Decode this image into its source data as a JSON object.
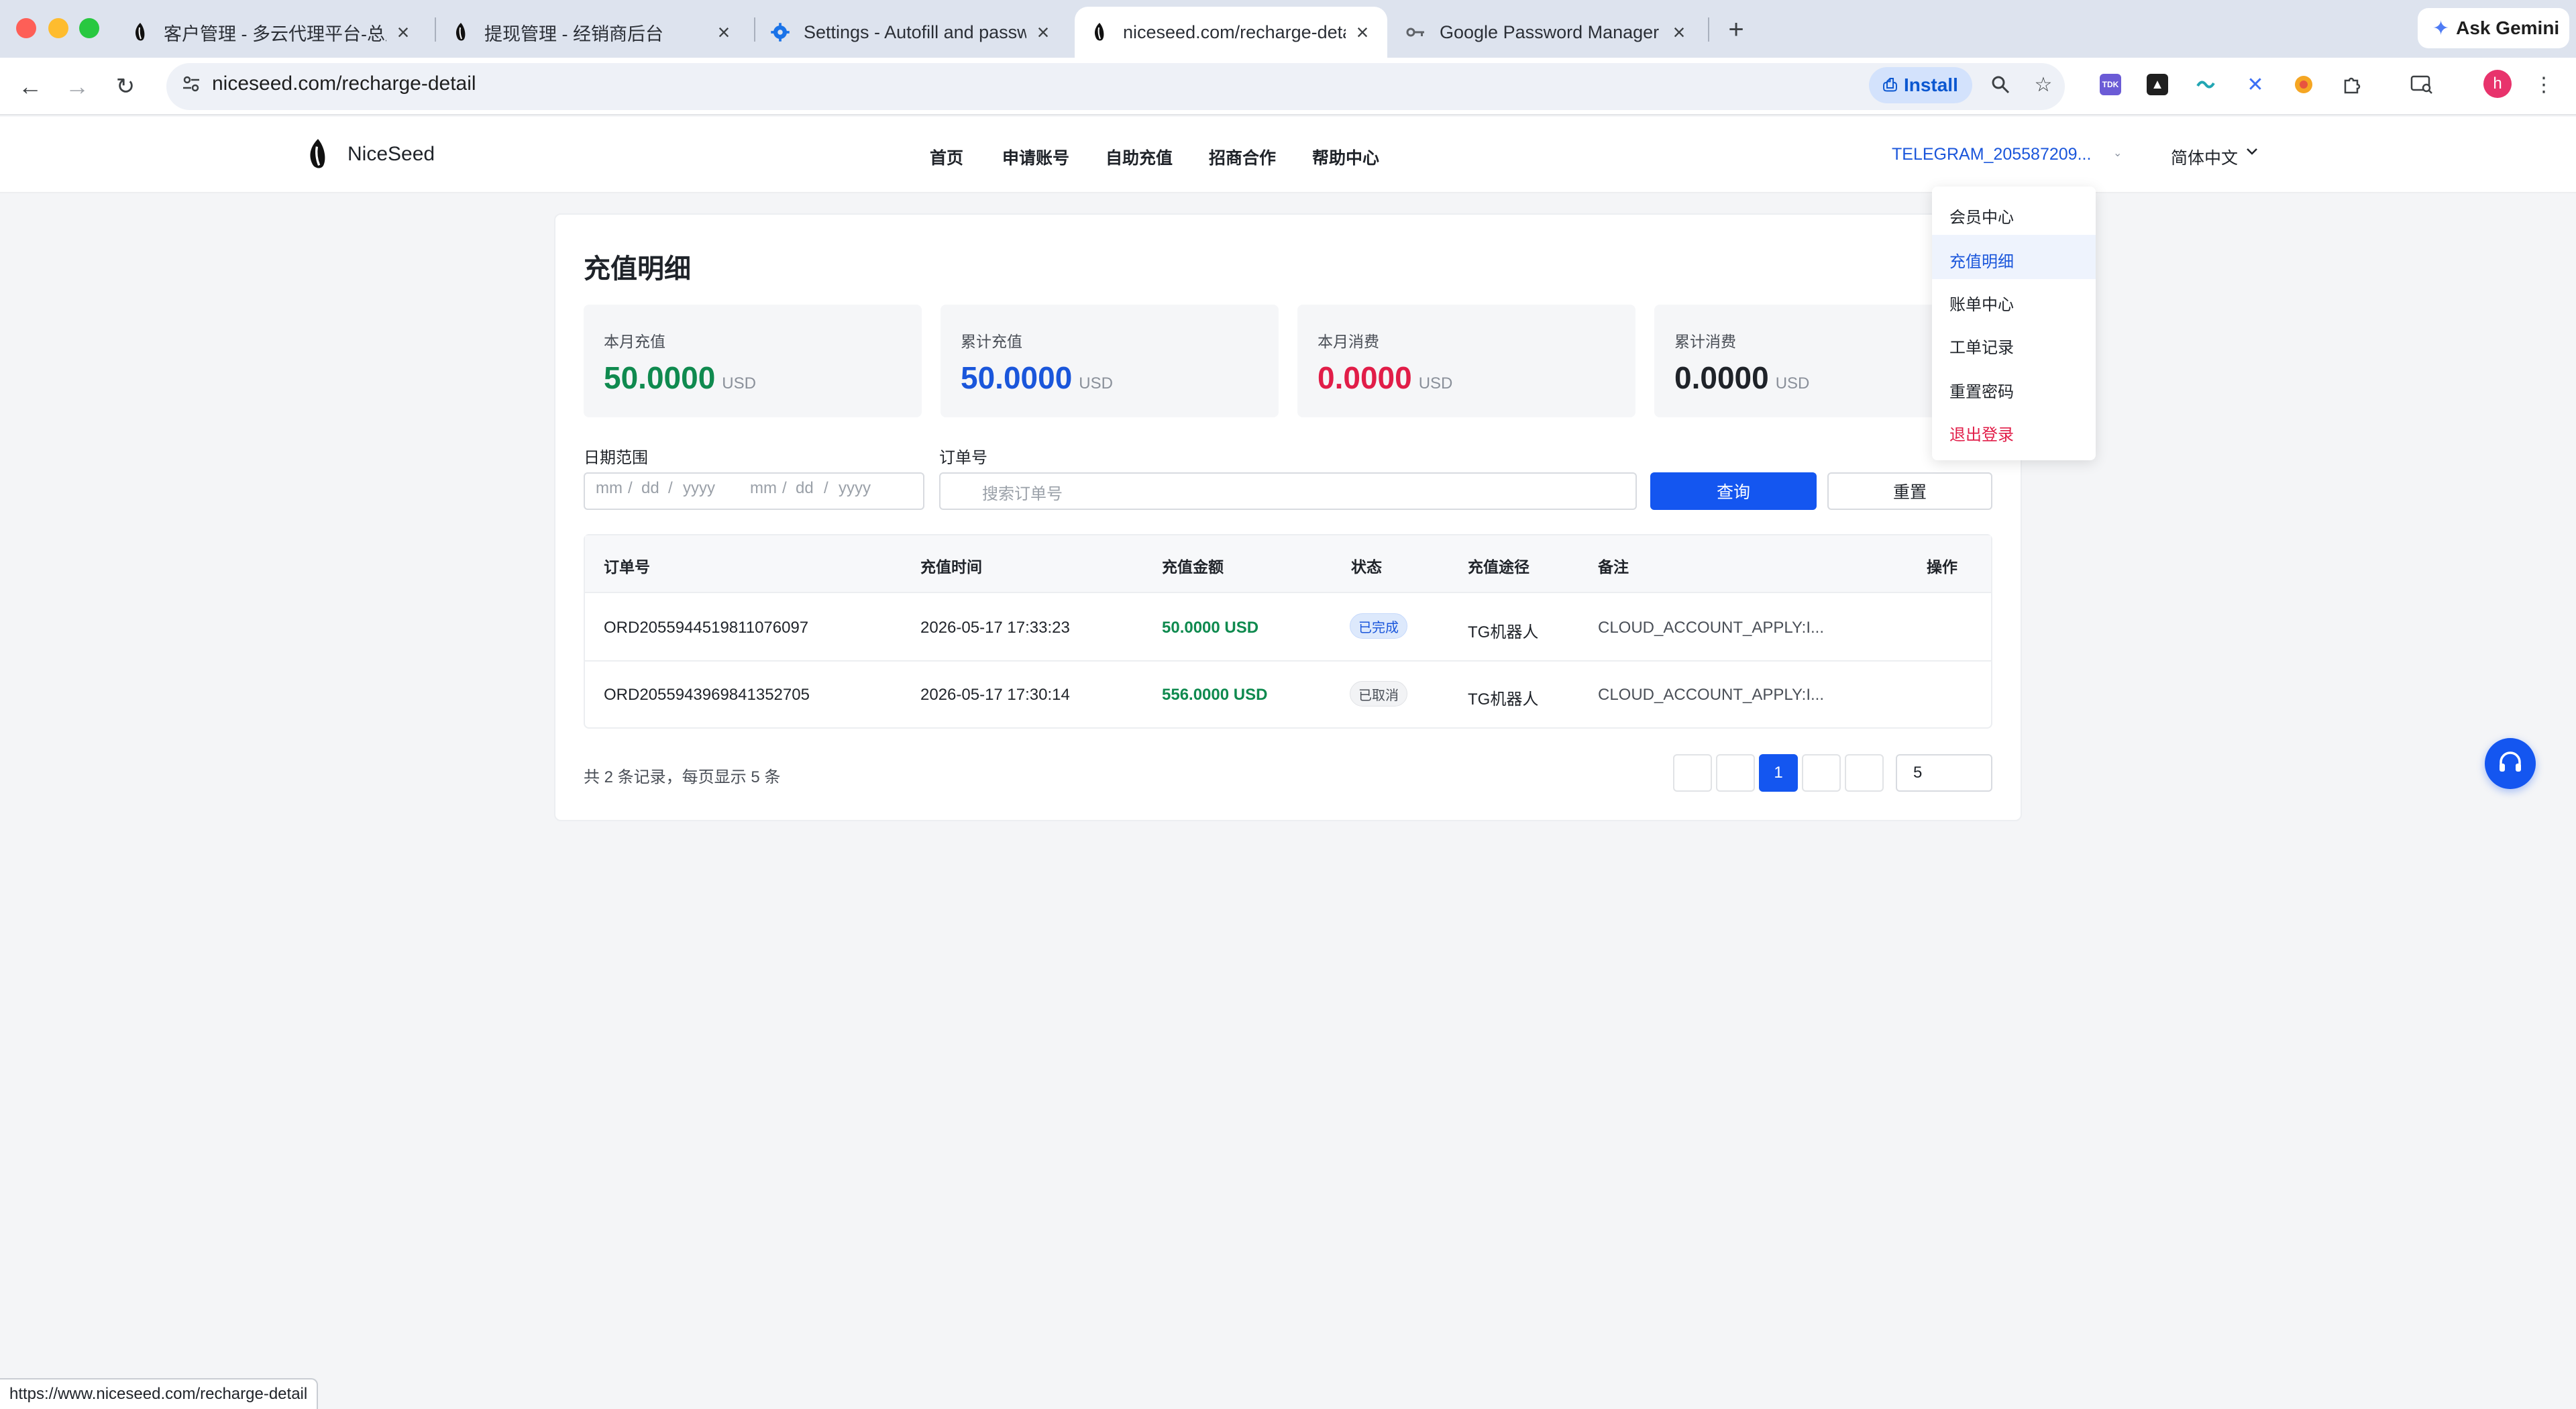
{
  "browser": {
    "tabs": [
      {
        "title": "客户管理 - 多云代理平台-总后台"
      },
      {
        "title": "提现管理 - 经销商后台"
      },
      {
        "title": "Settings - Autofill and passwords"
      },
      {
        "title": "niceseed.com/recharge-detail"
      },
      {
        "title": "Google Password Manager"
      }
    ],
    "new_tab": "+",
    "ask_gemini": "Ask Gemini",
    "url": "niceseed.com/recharge-detail",
    "install_label": "Install",
    "profile_initial": "h",
    "status_url": "https://www.niceseed.com/recharge-detail"
  },
  "site": {
    "brand": "NiceSeed",
    "nav": [
      "首页",
      "申请账号",
      "自助充值",
      "招商合作",
      "帮助中心"
    ],
    "user": "TELEGRAM_205587209...",
    "language": "简体中文"
  },
  "dropdown": {
    "items": [
      "会员中心",
      "充值明细",
      "账单中心",
      "工单记录",
      "重置密码",
      "退出登录"
    ],
    "active_index": 1
  },
  "page": {
    "title": "充值明细",
    "stats": [
      {
        "label": "本月充值",
        "value": "50.0000",
        "unit": "USD",
        "color": "#0f8a4f"
      },
      {
        "label": "累计充值",
        "value": "50.0000",
        "unit": "USD",
        "color": "#1a56db"
      },
      {
        "label": "本月消费",
        "value": "0.0000",
        "unit": "USD",
        "color": "#e11d48"
      },
      {
        "label": "累计消费",
        "value": "0.0000",
        "unit": "USD",
        "color": "#1f2329"
      }
    ],
    "filters": {
      "date_label": "日期范围",
      "date_placeholder": [
        "mm",
        "dd",
        "yyyy",
        "mm",
        "dd",
        "yyyy"
      ],
      "order_label": "订单号",
      "order_placeholder": "搜索订单号",
      "query_button": "查询",
      "reset_button": "重置"
    },
    "table": {
      "columns": [
        "订单号",
        "充值时间",
        "充值金额",
        "状态",
        "充值途径",
        "备注",
        "操作"
      ],
      "rows": [
        {
          "order": "ORD2055944519811076097",
          "time": "2026-05-17 17:33:23",
          "amount": "50.0000 USD",
          "status": "已完成",
          "channel": "TG机器人",
          "remark": "CLOUD_ACCOUNT_APPLY:I..."
        },
        {
          "order": "ORD2055943969841352705",
          "time": "2026-05-17 17:30:14",
          "amount": "556.0000 USD",
          "status": "已取消",
          "channel": "TG机器人",
          "remark": "CLOUD_ACCOUNT_APPLY:I..."
        }
      ]
    },
    "pagination": {
      "summary": "共 2 条记录，每页显示 5 条",
      "current_page": "1",
      "page_size": "5"
    }
  }
}
